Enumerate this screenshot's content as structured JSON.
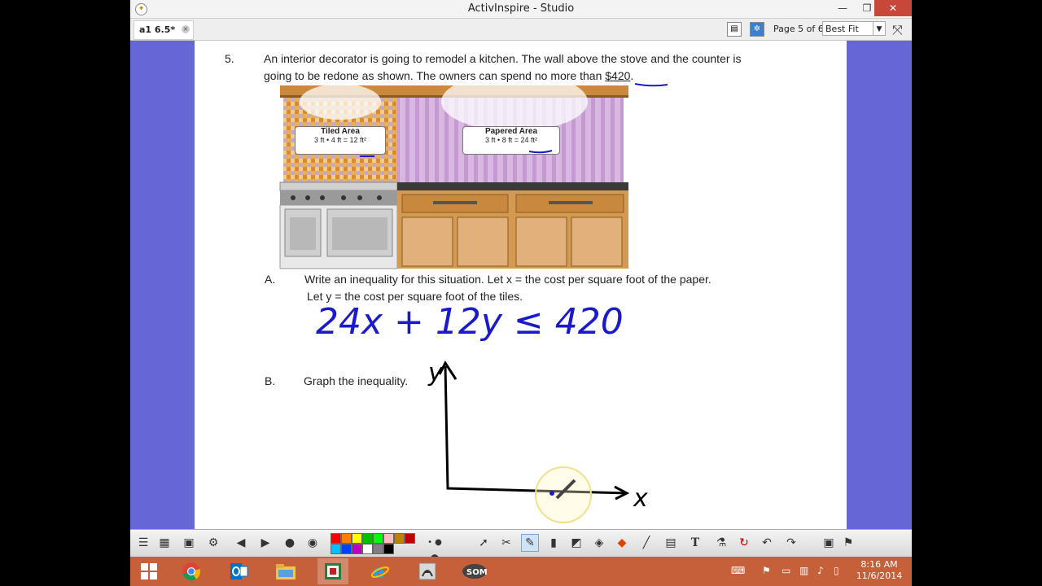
{
  "window": {
    "title": "ActivInspire - Studio"
  },
  "tabs": [
    {
      "label": "a1 6.5*"
    }
  ],
  "page_nav": {
    "page_info": "Page 5 of 6",
    "zoom": "Best Fit"
  },
  "question": {
    "number": "5.",
    "line1": "An interior decorator is going to remodel a kitchen. The wall above the stove and the counter is",
    "line2_prefix": "going to be redone as shown. The owners can spend no more than ",
    "line2_amount": "$420",
    "line2_suffix": ".",
    "tiled_title": "Tiled Area",
    "tiled_formula": "3 ft • 4 ft = 12 ft²",
    "papered_title": "Papered Area",
    "papered_formula": "3 ft • 8 ft = 24 ft²",
    "part_a_label": "A.",
    "part_a_line1": "Write an inequality for this situation. Let x = the cost per square foot of the paper.",
    "part_a_line2": "Let y = the cost per square foot of the tiles.",
    "part_b_label": "B.",
    "part_b_text": "Graph the inequality."
  },
  "handwriting": {
    "inequality": "24x + 12y ≤ 420",
    "y_axis_label": "y",
    "x_axis_label": "x"
  },
  "colors": {
    "ink_blue": "#1a1acc",
    "ink_black": "#000000",
    "canvas_bg": "#6666d6",
    "taskbar": "#c6603a"
  },
  "palette": [
    "#ff0000",
    "#ff8000",
    "#ffff00",
    "#00c000",
    "#00ff00",
    "#f4c0c0",
    "#c08000",
    "#c00000",
    "#00c0ff",
    "#0040ff",
    "#c000c0",
    "#ffffff",
    "#808080",
    "#000000"
  ],
  "taskbar": {
    "apps": [
      "windows-logo",
      "chrome",
      "outlook",
      "file-explorer",
      "activinspire",
      "internet-explorer",
      "adobe",
      "screencast"
    ],
    "time": "8:16 AM",
    "date": "11/6/2014"
  }
}
